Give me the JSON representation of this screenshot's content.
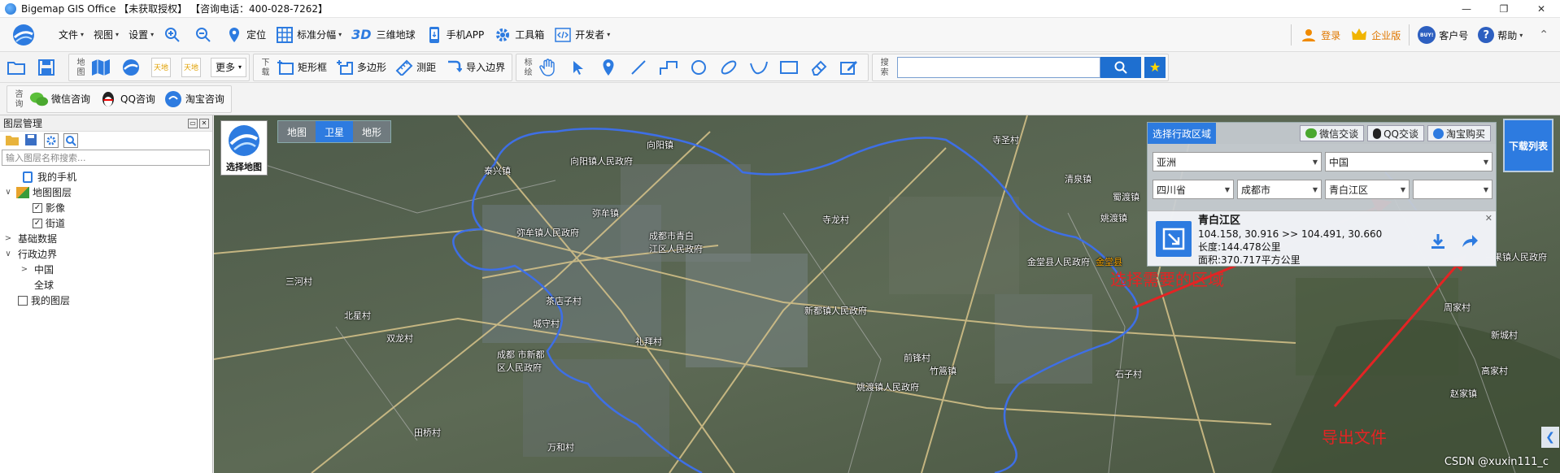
{
  "window": {
    "title": "Bigemap GIS Office 【未获取授权】   【咨询电话：400-028-7262】",
    "controls": [
      "—",
      "❐",
      "✕"
    ]
  },
  "menubar": {
    "items": [
      {
        "label": "文件",
        "caret": "▾"
      },
      {
        "label": "视图",
        "caret": "▾"
      },
      {
        "label": "设置",
        "caret": "▾"
      }
    ],
    "tools": [
      {
        "label": "定位"
      },
      {
        "label": "标准分幅",
        "caret": "▾"
      },
      {
        "label": "三维地球",
        "badge": "3D"
      },
      {
        "label": "手机APP"
      },
      {
        "label": "工具箱"
      },
      {
        "label": "开发者",
        "caret": "▾"
      }
    ],
    "right": {
      "login": "登录",
      "enterprise": "企业版",
      "account": "客户号",
      "help": "帮助",
      "buy_badge": "BUY!"
    }
  },
  "toolbar": {
    "map_label": "地图",
    "more": "更多",
    "download_label": "下载",
    "rect": "矩形框",
    "polygon": "多边形",
    "measure": "测距",
    "import_boundary": "导入边界",
    "annotate_label": "标绘",
    "search_label": "搜索",
    "search_value": ""
  },
  "toolbar3": {
    "consult_label": "咨询",
    "wechat": "微信咨询",
    "qq": "QQ咨询",
    "taobao": "淘宝咨询"
  },
  "layer_panel": {
    "title": "图层管理",
    "search_placeholder": "输入图层名称搜索...",
    "tree": [
      {
        "label": "我的手机",
        "level": 1
      },
      {
        "label": "地图图层",
        "level": 0,
        "toggle": "∨"
      },
      {
        "label": "影像",
        "level": 2,
        "checked": true
      },
      {
        "label": "街道",
        "level": 2,
        "checked": true
      },
      {
        "label": "基础数据",
        "level": 0,
        "toggle": ">"
      },
      {
        "label": "行政边界",
        "level": 0,
        "toggle": "∨"
      },
      {
        "label": "中国",
        "level": 1,
        "toggle": ">"
      },
      {
        "label": "全球",
        "level": 1
      },
      {
        "label": "我的图层",
        "level": 0,
        "checked": false
      }
    ]
  },
  "map": {
    "select_map": "选择地图",
    "map_types": [
      "地图",
      "卫星",
      "地形"
    ],
    "active_type": "卫星",
    "labels": [
      "向阳镇",
      "向阳镇人民政府",
      "泰兴镇",
      "弥牟镇",
      "成都市青白",
      "江区人民政府",
      "弥牟镇人民政府",
      "寺圣村",
      "寺龙村",
      "姚渡镇",
      "蜀渡镇",
      "清泉镇",
      "三河村",
      "北星村",
      "双龙村",
      "茶店子村",
      "城守村",
      "礼拜村",
      "新都镇人民政府",
      "成都 市新都",
      "区人民政府",
      "前锋村",
      "姚渡镇人民政府",
      "金堂县人民政府",
      "金堂县",
      "石子村",
      "竹篙镇",
      "万和村",
      "田桥村",
      "高家村",
      "白果镇人民政府",
      "新城村",
      "赵家镇",
      "周家村"
    ],
    "red_annotation_1": "选择需要的区域",
    "red_annotation_2": "导出文件",
    "watermark": "CSDN @xuxin111_c"
  },
  "region_panel": {
    "title": "选择行政区域",
    "wechat": "微信交谈",
    "qq": "QQ交谈",
    "taobao": "淘宝购买",
    "continent": "亚洲",
    "country": "中国",
    "province": "四川省",
    "city": "成都市",
    "district": "青白江区",
    "town": "",
    "result": {
      "name": "青白江区",
      "bounds": "104.158,  30.916 >> 104.491,  30.660",
      "length": "长度:144.478公里",
      "area": "面积:370.717平方公里"
    }
  },
  "download_list": "下载列表",
  "colors": {
    "accent": "#2d7be0",
    "annotation": "#e32424",
    "boundary": "#3e6fe6"
  }
}
